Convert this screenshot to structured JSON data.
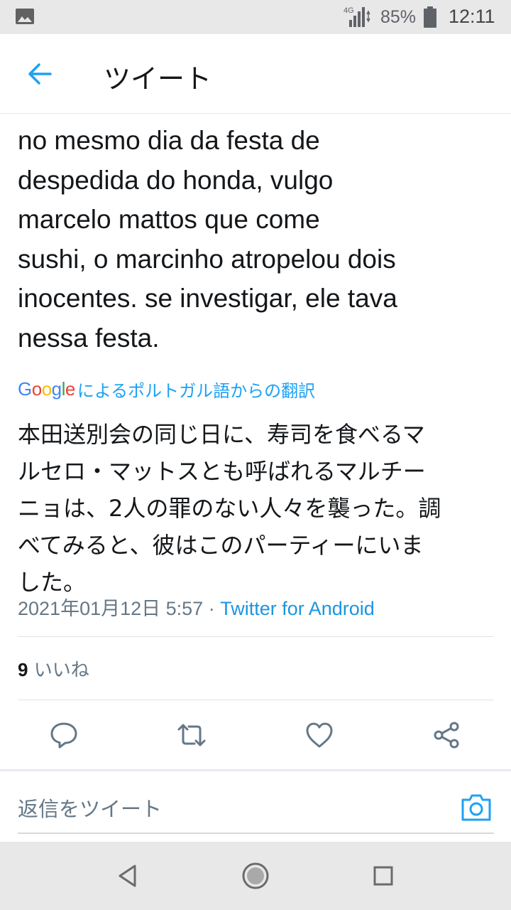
{
  "status_bar": {
    "network": "4G",
    "battery": "85%",
    "time": "12:11",
    "icons": [
      "image-icon",
      "signal-icon",
      "battery-icon"
    ]
  },
  "app_bar": {
    "title": "ツイート",
    "back_icon": "arrow-left-icon"
  },
  "tweet": {
    "lines": [
      "no mesmo dia da festa de",
      "despedida do honda, vulgo",
      "marcelo mattos que come",
      "sushi, o marcinho atropelou dois",
      "inocentes. se investigar, ele tava",
      "nessa festa."
    ],
    "translation_credit": "Google",
    "translation_label": "によるポルトガル語からの翻訳",
    "translated_lines": [
      "本田送別会の同じ日に、寿司を食べるマ",
      "ルセロ・マットスとも呼ばれるマルチー",
      "ニョは、2人の罪のない人々を襲った。調",
      "べてみると、彼はこのパーティーにいま",
      "した。"
    ],
    "timestamp": "2021年01月12日 5:57",
    "separator": "·",
    "source": "Twitter for Android",
    "likes_count": "9",
    "likes_label": "いいね"
  },
  "actions": [
    "reply-icon",
    "retweet-icon",
    "like-icon",
    "share-icon"
  ],
  "reply_bar": {
    "placeholder": "返信をツイート",
    "camera_icon": "camera-icon"
  },
  "nav_bar": [
    "back-triangle-icon",
    "home-circle-icon",
    "recents-square-icon"
  ],
  "colors": {
    "accent": "#1da1f2",
    "link": "#1b95e0",
    "secondary_text": "#657786",
    "text": "#14171a",
    "status_bar": "#e8e8e8"
  }
}
